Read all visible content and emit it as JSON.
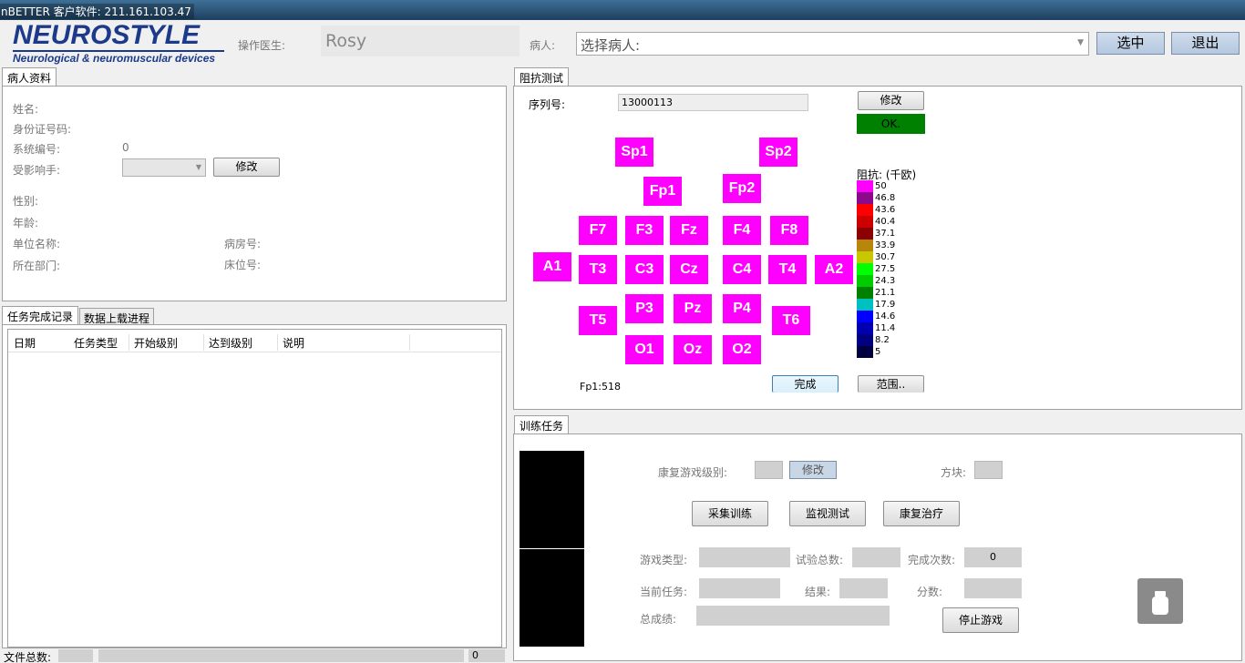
{
  "window": {
    "title": "nBETTER 客户软件: 211.161.103.47"
  },
  "logo": {
    "main": "NEUROSTYLE",
    "sub": "Neurological & neuromuscular devices"
  },
  "header": {
    "operator_label": "操作医生:",
    "operator_value": "Rosy",
    "patient_label": "病人:",
    "patient_select": "选择病人:",
    "select_button": "选中",
    "exit_button": "退出"
  },
  "patient_info": {
    "tab": "病人资料",
    "name_label": "姓名:",
    "id_label": "身份证号码:",
    "sysno_label": "系统编号:",
    "sysno_value": "0",
    "handed_label": "受影响手:",
    "edit_button": "修改",
    "gender_label": "性别:",
    "age_label": "年龄:",
    "unit_label": "单位名称:",
    "ward_label": "病房号:",
    "dept_label": "所在部门:",
    "bed_label": "床位号:"
  },
  "records": {
    "tab_active": "任务完成记录",
    "tab_inactive": "数据上载进程",
    "columns": [
      "日期",
      "任务类型",
      "开始级别",
      "达到级别",
      "说明"
    ]
  },
  "footer": {
    "file_total_label": "文件总数:",
    "count_value": "0"
  },
  "impedance": {
    "tab": "阻抗测试",
    "serial_label": "序列号:",
    "serial_value": "13000113",
    "edit_button": "修改",
    "status": "OK.",
    "electrodes": [
      "Sp1",
      "Sp2",
      "Fp1",
      "Fp2",
      "F7",
      "F3",
      "Fz",
      "F4",
      "F8",
      "A1",
      "T3",
      "C3",
      "Cz",
      "C4",
      "T4",
      "A2",
      "T5",
      "P3",
      "Pz",
      "P4",
      "T6",
      "O1",
      "Oz",
      "O2"
    ],
    "readout": "Fp1:518",
    "done_button": "完成",
    "range_button": "范围..",
    "legend_title": "阻抗: (千欧)",
    "legend": [
      {
        "label": "50",
        "color": "#ff00ff"
      },
      {
        "label": "46.8",
        "color": "#8b0a8b"
      },
      {
        "label": "43.6",
        "color": "#ff0000"
      },
      {
        "label": "40.4",
        "color": "#cc0000"
      },
      {
        "label": "37.1",
        "color": "#8b0000"
      },
      {
        "label": "33.9",
        "color": "#b8860b"
      },
      {
        "label": "30.7",
        "color": "#c8c800"
      },
      {
        "label": "27.5",
        "color": "#00ff00"
      },
      {
        "label": "24.3",
        "color": "#00cc00"
      },
      {
        "label": "21.1",
        "color": "#008000"
      },
      {
        "label": "17.9",
        "color": "#00c0c0"
      },
      {
        "label": "14.6",
        "color": "#0000ff"
      },
      {
        "label": "11.4",
        "color": "#0000b0"
      },
      {
        "label": "8.2",
        "color": "#000080"
      },
      {
        "label": "5",
        "color": "#000040"
      }
    ]
  },
  "training": {
    "tab": "训练任务",
    "level_label": "康复游戏级别:",
    "edit_button": "修改",
    "block_label": "方块:",
    "collect_button": "采集训练",
    "monitor_button": "监视测试",
    "rehab_button": "康复治疗",
    "game_type_label": "游戏类型:",
    "trial_total_label": "试验总数:",
    "done_count_label": "完成次数:",
    "done_count_value": "0",
    "current_task_label": "当前任务:",
    "result_label": "结果:",
    "score_label": "分数:",
    "total_label": "总成绩:",
    "stop_button": "停止游戏"
  }
}
